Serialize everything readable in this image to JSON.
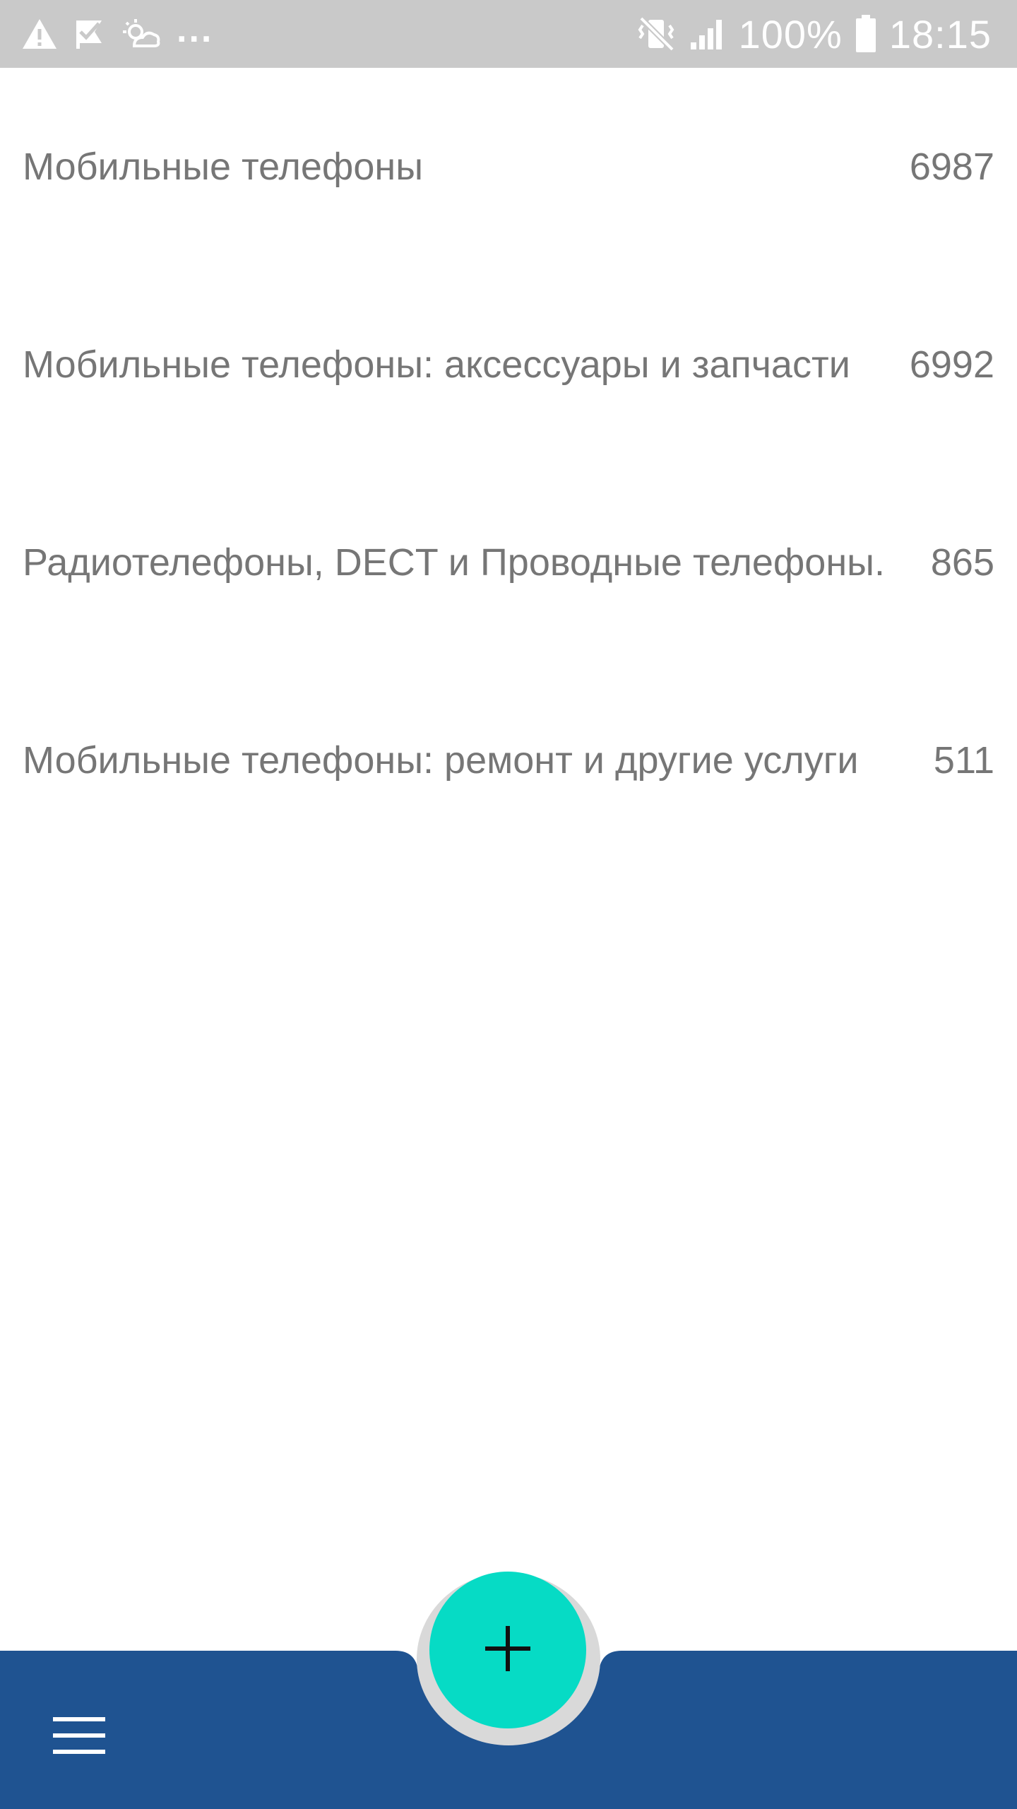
{
  "status_bar": {
    "icons_left": [
      "warning-icon",
      "check-flag-icon",
      "weather-icon"
    ],
    "overflow": "...",
    "icons_right": [
      "vibrate-mute-icon",
      "signal-icon",
      "battery-icon"
    ],
    "battery": "100%",
    "time": "18:15"
  },
  "categories": [
    {
      "name": "Мобильные телефоны",
      "count": "6987"
    },
    {
      "name": "Мобильные телефоны: аксессуары и запчасти",
      "count": "6992"
    },
    {
      "name": "Радиотелефоны, DECT и Проводные телефоны.",
      "count": "865"
    },
    {
      "name": "Мобильные телефоны: ремонт и другие услуги",
      "count": "511"
    }
  ],
  "bottom_bar": {
    "menu_icon": "hamburger-menu-icon",
    "fab_icon": "plus-icon",
    "bar_color": "#1f5391",
    "fab_color": "#06dbc5"
  }
}
